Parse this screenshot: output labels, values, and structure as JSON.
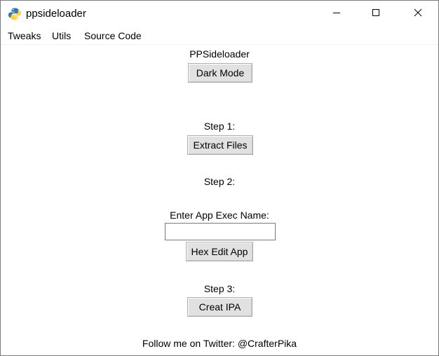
{
  "window": {
    "title": "ppsideloader",
    "icon": "python-icon"
  },
  "menubar": {
    "tweaks": "Tweaks",
    "utils": "Utils",
    "source_code": "Source Code"
  },
  "main": {
    "app_title": "PPSideloader",
    "dark_mode_label": "Dark Mode",
    "step1_label": "Step 1:",
    "extract_files_label": "Extract Files",
    "step2_label": "Step 2:",
    "exec_name_label": "Enter App Exec Name:",
    "exec_name_value": "",
    "hex_edit_label": "Hex Edit App",
    "step3_label": "Step 3:",
    "create_ipa_label": "Creat IPA",
    "footer": "Follow me on Twitter: @CrafterPika"
  }
}
